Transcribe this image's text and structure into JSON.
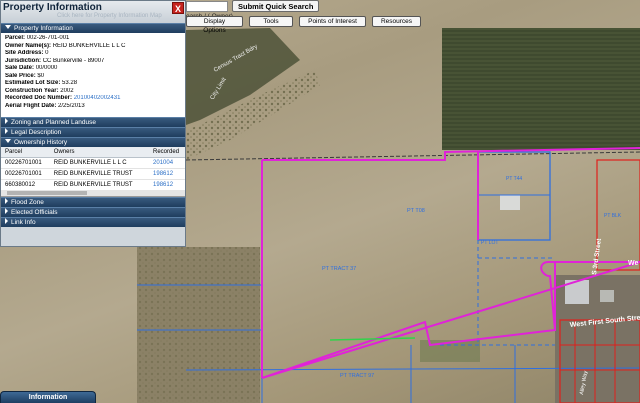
{
  "search": {
    "button_label": "Submit Quick Search",
    "hint": "earch / ( Owner)",
    "value": ""
  },
  "toolbar": {
    "display_options": "Display Options",
    "tools": "Tools",
    "points_of_interest": "Points of Interest",
    "resources": "Resources"
  },
  "panel": {
    "title": "Property Information",
    "subtitle": "Click here for Property Information Map",
    "close_glyph": "X",
    "sections": {
      "property_information": "Property Information",
      "zoning": "Zoning and Planned Landuse",
      "legal": "Legal Description",
      "ownership": "Ownership History",
      "flood": "Flood Zone",
      "elected": "Elected Officials",
      "link": "Link Info"
    },
    "info": {
      "parcel_label": "Parcel:",
      "parcel_value": "002-26-701-001",
      "owner_label": "Owner Name(s):",
      "owner_value": "REID BUNKERVILLE L L C",
      "site_label": "Site Address:",
      "site_value": "0",
      "juris_label": "Jurisdiction:",
      "juris_value": "CC Bunkerville - 89007",
      "sale_date_label": "Sale Date:",
      "sale_date_value": "00/0000",
      "sale_price_label": "Sale Price:",
      "sale_price_value": "$0",
      "lot_label": "Estimated Lot Size:",
      "lot_value": "53.28",
      "constr_label": "Construction Year:",
      "constr_value": "2002",
      "doc_label": "Recorded Doc Number:",
      "doc_value": "20100402002431",
      "flight_label": "Aerial Flight Date:",
      "flight_value": "2/25/2013"
    },
    "ownership_table": {
      "headers": [
        "Parcel",
        "Owners",
        "Recorded"
      ],
      "rows": [
        [
          "00226701001",
          "REID BUNKERVILLE L L C",
          "201004"
        ],
        [
          "00226701001",
          "REID BUNKERVILLE TRUST",
          "198612"
        ],
        [
          "660380012",
          "REID BUNKERVILLE TRUST",
          "198612"
        ]
      ]
    }
  },
  "map": {
    "labels": {
      "trail": "Census Tract Bdry",
      "limit": "City Limit",
      "tract_a": "PT TRACT 37",
      "tract_b": "PT TRACT 97",
      "parcel_id": "PT T08",
      "street_south": "West First South Street",
      "street_vertical": "S 3rd Street",
      "street_right": "We",
      "small_a": "PT LOT",
      "small_b": "PT T44",
      "small_c": "PT BLK",
      "alley": "Alley Way"
    },
    "colors": {
      "parcel_outline": "#e023d8",
      "parcel_lines": "#2f6fe0",
      "red_lots": "#e0201c"
    }
  },
  "bottom_tab": "Information"
}
